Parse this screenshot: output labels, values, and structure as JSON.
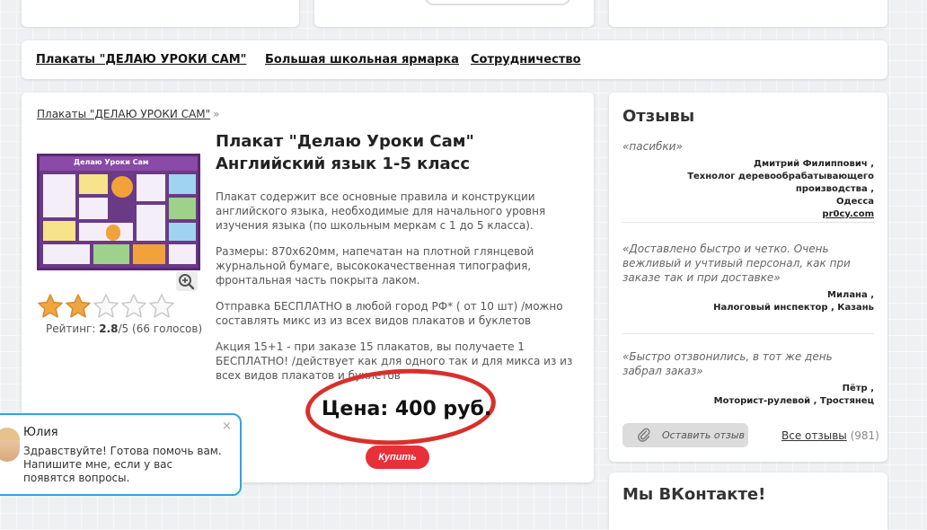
{
  "nav": {
    "items": [
      "Плакаты \"ДЕЛАЮ УРОКИ САМ\"",
      "Большая школьная ярмарка",
      "Сотрудничество"
    ]
  },
  "breadcrumb": {
    "item": "Плакаты \"ДЕЛАЮ УРОКИ САМ\"",
    "separator": "»"
  },
  "product": {
    "title": "Плакат \"Делаю Уроки Сам\" Английский язык 1-5 класс",
    "poster_title": "Делаю Уроки Сам",
    "desc": [
      "Плакат содержит все основные правила и конструкции английского языка, необходимые для начального уровня изучения языка (по школьным меркам с 1 до 5 класса).",
      "Размеры: 870х620мм, напечатан на плотной глянцевой журнальной бумаге, высококачественная типография, фронтальная часть покрыта лаком.",
      "Отправка БЕСПЛАТНО в любой город РФ* ( от 10 шт) /можно составлять микс из из всех видов плакатов и буклетов",
      "Акция 15+1 - при заказе 15 плакатов, вы получаете 1 БЕСПЛАТНО! /действует как для одного так и для микса из из всех видов плакатов и буклетов"
    ],
    "price": "Цена: 400 руб.",
    "buy_label": "Купить",
    "rating": {
      "label": "Рейтинг:",
      "value": "2.8",
      "max": "/5",
      "votes": "(66 голосов)",
      "stars_value": 2,
      "stars_max": 5
    }
  },
  "reviews": {
    "title": "Отзывы",
    "items": [
      {
        "text": "«пасибки»",
        "author": "Дмитрий Филиппович ,",
        "job": "Технолог деревообрабатывающего производства ,",
        "city": "Одесса",
        "link": "pr0cy.com"
      },
      {
        "text": "«Доставлено быстро и четко. Очень вежливый и учтивый персонал, как при заказе так и при доставке»",
        "author": "Милана ,",
        "job": "Налоговый инспектор , Казань"
      },
      {
        "text": "«Быстро отзвонились, в тот же день забрал заказ»",
        "author": "Пётр ,",
        "job": "Моторист-рулевой , Тростянец"
      }
    ],
    "leave_label": "Оставить отзыв",
    "all_label": "Все отзывы",
    "all_count": "(981)"
  },
  "vk": {
    "title": "Мы ВКонтакте!"
  },
  "chat": {
    "name": "Юлия",
    "message": "Здравствуйте! Готова помочь вам. Напишите мне, если у вас появятся вопросы.",
    "close": "×"
  },
  "colors": {
    "price_ring": "#d9302c",
    "buy_button": "#e8303a",
    "star_filled": "#f0a640",
    "chat_border": "#2fa4e7"
  }
}
